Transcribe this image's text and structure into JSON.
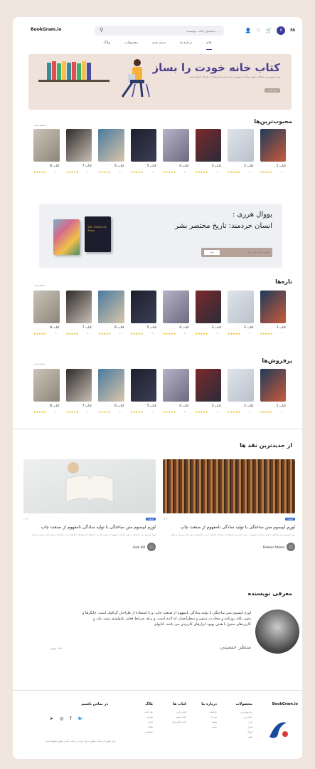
{
  "header": {
    "logo": "BookGram.io",
    "search_placeholder": "جستجوی کتاب، نویسنده، ...",
    "badge": "0",
    "lang": "FA"
  },
  "nav": [
    "خانه",
    "درباره ما",
    "دسته بندی",
    "محصولات",
    "وبلاگ"
  ],
  "hero": {
    "title": "کتاب خانه خودت را بساز",
    "subtitle": "لورم ایپسوم متن ساختگی با تولید سادگی نامفهوم از صنعت چاپ و با استفاده از طراحان گرافیک است.",
    "cta": "خرید کتاب"
  },
  "colors": {
    "accent": "#3a3a9c",
    "brand_bg": "#f1e6df",
    "hero_bg": "#efe2da",
    "gold": "#e0b400"
  },
  "sections": {
    "popular": {
      "title": "محبوب‌ترین‌ها",
      "seeall": "مشاهده همه"
    },
    "newest": {
      "title": "تازه‌ها",
      "seeall": "مشاهده همه"
    },
    "bestsellers": {
      "title": "پرفروش‌ها",
      "seeall": "مشاهده همه"
    }
  },
  "popular": [
    {
      "name": "کتاب 1",
      "stars": "★★★★★",
      "price": "۲۰۰۰"
    },
    {
      "name": "کتاب 2",
      "stars": "★★★★★",
      "price": "۲۰۰۰"
    },
    {
      "name": "کتاب 3",
      "stars": "★★★★★",
      "price": "۲۰۰۰"
    },
    {
      "name": "کتاب 4",
      "stars": "★★★★★",
      "price": "۲۰۰۰"
    },
    {
      "name": "کتاب 5",
      "stars": "★★★★★",
      "price": "۲۰۰۰"
    },
    {
      "name": "کتاب 6",
      "stars": "★★★★★",
      "price": "۲۰۰۰"
    },
    {
      "name": "کتاب 7",
      "stars": "★★★★★",
      "price": "۲۰۰۰"
    },
    {
      "name": "کتاب 8",
      "stars": "★★★★★",
      "price": "۲۰۰۰"
    }
  ],
  "newest": [
    {
      "name": "کتاب 1",
      "stars": "★★★★★",
      "price": "۲۰۰۰"
    },
    {
      "name": "کتاب 2",
      "stars": "★★★★★",
      "price": "۲۰۰۰"
    },
    {
      "name": "کتاب 3",
      "stars": "★★★★★",
      "price": "۲۰۰۰"
    },
    {
      "name": "کتاب 4",
      "stars": "★★★★★",
      "price": "۲۰۰۰"
    },
    {
      "name": "کتاب 5",
      "stars": "★★★★★",
      "price": "۲۰۰۰"
    },
    {
      "name": "کتاب 6",
      "stars": "★★★★★",
      "price": "۲۰۰۰"
    },
    {
      "name": "کتاب 7",
      "stars": "★★★★★",
      "price": "۲۰۰۰"
    },
    {
      "name": "کتاب 8",
      "stars": "★★★★★",
      "price": "۲۰۰۰"
    }
  ],
  "bestsellers": [
    {
      "name": "کتاب 1",
      "stars": "★★★★★",
      "price": "۲۰۰۰"
    },
    {
      "name": "کتاب 2",
      "stars": "★★★★★",
      "price": "۲۰۰۰"
    },
    {
      "name": "کتاب 3",
      "stars": "★★★★★",
      "price": "۲۰۰۰"
    },
    {
      "name": "کتاب 4",
      "stars": "★★★★★",
      "price": "۲۰۰۰"
    },
    {
      "name": "کتاب 5",
      "stars": "★★★★★",
      "price": "۲۰۰۰"
    },
    {
      "name": "کتاب 6",
      "stars": "★★★★★",
      "price": "۲۰۰۰"
    },
    {
      "name": "کتاب 7",
      "stars": "★★★★★",
      "price": "۲۰۰۰"
    },
    {
      "name": "کتاب 8",
      "stars": "★★★★★",
      "price": "۲۰۰۰"
    }
  ],
  "promo": {
    "title": "یووال هرری :\nانسان خردمند: تاریخ مختصر بشر",
    "placeholder": "ایمیل خود را وارد کنید",
    "select": "ثبت",
    "book2_title": "The Order of Time"
  },
  "reviews": {
    "title": "از جدیدترین نقد ها",
    "items": [
      {
        "chip": "ادبیات",
        "date": "۱۴۰۲",
        "title": "لورم ایپسوم متن ساختگی با تولید سادگی نامفهوم از صنعت چاپ",
        "body": "لورم ایپسوم متن ساختگی با تولید سادگی نامفهوم از صنعت چاپ و با استفاده از طراحان گرافیک است. چاپگرها و متون بلکه روزنامه و مجله.",
        "author": "Eleanor Adams"
      },
      {
        "chip": "ادبیات",
        "date": "۱۴۰۲",
        "title": "لورم ایپسوم متن ساختگی با تولید سادگی نامفهوم از صنعت چاپ",
        "body": "لورم ایپسوم متن ساختگی با تولید سادگی نامفهوم از صنعت چاپ و با استفاده از طراحان گرافیک است. چاپگرها و متون بلکه روزنامه و مجله.",
        "author": "Liam Hill"
      }
    ]
  },
  "author_intro": {
    "title": "معرفی نویسنده",
    "text": "لورم ایپسوم متن ساختگی با تولید سادگی نامفهوم از صنعت چاپ، و با استفاده از طراحان گرافیک است، چاپگرها و متون بلکه روزنامه و مجله در ستون و سطرآنچنان که لازم است، و برای شرایط فعلی تکنولوژی مورد نیاز، و کاربردهای متنوع با هدف بهبود ابزارهای کاربردی می باشد، کتابهای",
    "name": "منظر حسینی",
    "more": "بیشتر >>"
  },
  "footer": {
    "brand": "BookGram.io",
    "cols": [
      {
        "title": "محصولات",
        "items": [
          "پرفروش‌ترین",
          "جدیدترین",
          "ادبی",
          "هنری",
          "کودک",
          "علمی"
        ]
      },
      {
        "title": "درباره ما",
        "items": [
          "تاریخچه",
          "تیم ما",
          "شعب",
          "تماس"
        ]
      },
      {
        "title": "کتاب ها",
        "items": [
          "کتاب چاپی",
          "کتاب صوتی",
          "کتاب الکترونیک"
        ]
      },
      {
        "title": "بلاگ",
        "items": [
          "نقد کتاب",
          "معرفی",
          "اخبار",
          "مقاله",
          "مصاحبه"
        ]
      }
    ],
    "contact_title": "در تماس باشیم",
    "copyright": "کلیه حقوق این سایت متعلق به بوک گرام می باشد. تمامی حقوق محفوظ است."
  }
}
